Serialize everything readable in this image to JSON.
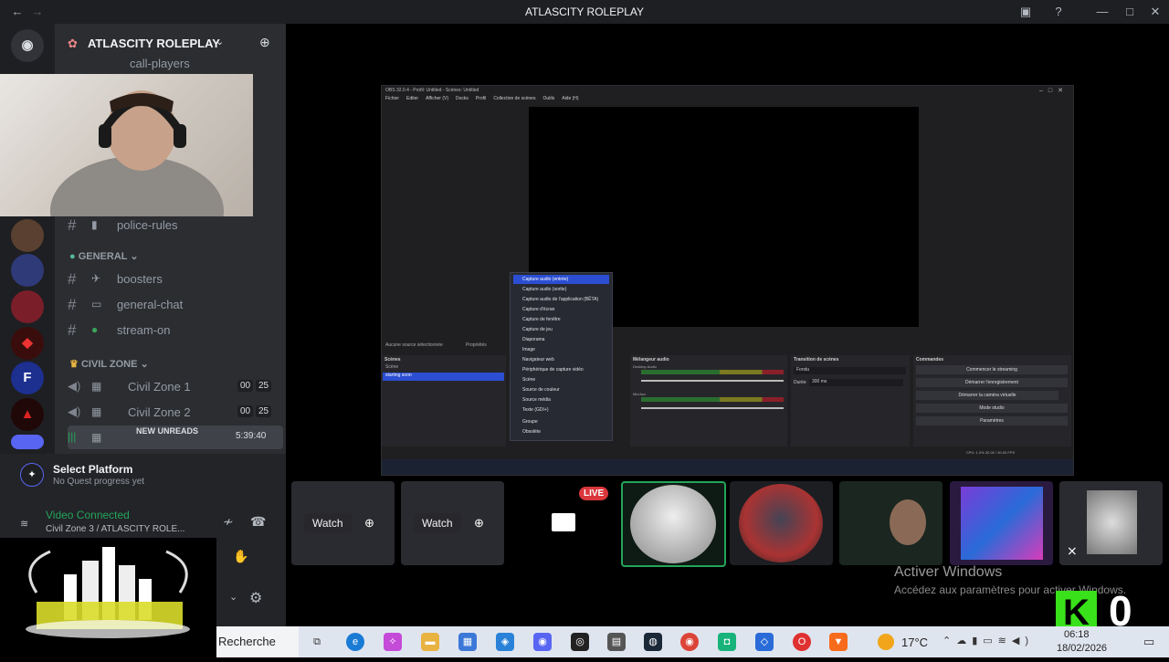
{
  "window": {
    "title": "ATLASCITY ROLEPLAY"
  },
  "server": {
    "name": "ATLASCITY ROLEPLAY"
  },
  "channels": {
    "top_cut": "call-players",
    "police_rules": "police-rules",
    "general_category": "GENERAL",
    "boosters": "boosters",
    "general_chat": "general-chat",
    "stream_on": "stream-on",
    "civil_category": "CIVIL ZONE",
    "civil1": {
      "label": "Civil Zone 1",
      "a": "00",
      "b": "25"
    },
    "civil2": {
      "label": "Civil Zone 2",
      "a": "00",
      "b": "25"
    },
    "current_time": "5:39:40",
    "new_unreads": "NEW UNREADS"
  },
  "user_panel": {
    "platform_title": "Select Platform",
    "platform_sub": "No Quest progress yet",
    "voice_status": "Video Connected",
    "voice_channel": "Civil Zone 3 / ATLASCITY ROLE..."
  },
  "obs": {
    "title": "OBS 32.0.4 - Profil: Untitled - Scènes: Untitled",
    "menu": [
      "Fichier",
      "Editer",
      "Afficher (V)",
      "Docks",
      "Profil",
      "Collection de scènes",
      "Outils",
      "Aide (H)"
    ],
    "scenes_title": "Scènes",
    "scenes": [
      "Scène",
      "starting soon"
    ],
    "mixer_title": "Mélangeur audio",
    "mixer_tracks": [
      "Desktop Audio",
      "Mic/Aux"
    ],
    "transition_title": "Transition de scènes",
    "transition_value": "Fondu",
    "duration_label": "Durée",
    "duration_value": "300 ms",
    "controls_title": "Commandes",
    "controls": [
      "Commencer le streaming",
      "Démarrer l'enregistrement",
      "Démarrer la caméra virtuelle",
      "Mode studio",
      "Paramètres"
    ],
    "no_source": "Aucune source sélectionnée",
    "properties": "Propriétés",
    "status": "CPU: 1.0%   30.00 / 30.00 FPS",
    "context_menu": [
      "Capture audio (entrée)",
      "Capture audio (sortie)",
      "Capture audio de l'application (BÊTA)",
      "Capture d'écran",
      "Capture de fenêtre",
      "Capture de jeu",
      "Diaporama",
      "Image",
      "Navigateur web",
      "Périphérique de capture vidéo",
      "Scène",
      "Source de couleur",
      "Source média",
      "Texte (GDI+)",
      "Groupe",
      "Obsolète"
    ]
  },
  "stage": {
    "watch1": "Watch",
    "watch2": "Watch",
    "live_badge": "LIVE"
  },
  "watermark": {
    "line1": "Activer Windows",
    "line2": "Accédez aux paramètres pour activer Windows."
  },
  "overlay": {
    "score": "0"
  },
  "taskbar": {
    "search": "Recherche",
    "weather": "17°C",
    "time": "06:18",
    "date": "18/02/2026"
  }
}
